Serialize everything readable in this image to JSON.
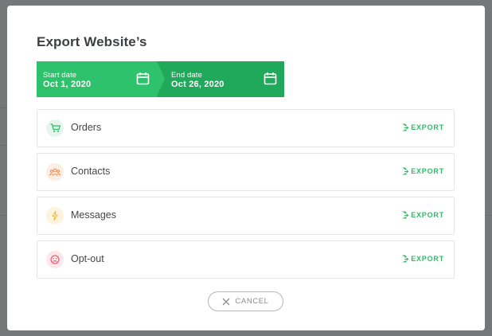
{
  "modal": {
    "title": "Export Website’s",
    "date_range": {
      "start_label": "Start date",
      "start_value": "Oct 1, 2020",
      "end_label": "End date",
      "end_value": "Oct 26, 2020"
    },
    "rows": [
      {
        "label": "Orders",
        "icon": "cart-icon",
        "action": "EXPORT",
        "icon_color": "#2dbb66",
        "icon_bg": "#e6f6ec"
      },
      {
        "label": "Contacts",
        "icon": "people-icon",
        "action": "EXPORT",
        "icon_color": "#f08a4b",
        "icon_bg": "#fdeee4"
      },
      {
        "label": "Messages",
        "icon": "bolt-icon",
        "action": "EXPORT",
        "icon_color": "#f5b82e",
        "icon_bg": "#fdf4de"
      },
      {
        "label": "Opt-out",
        "icon": "frown-icon",
        "action": "EXPORT",
        "icon_color": "#e5485f",
        "icon_bg": "#fde7ea"
      }
    ],
    "cancel_label": "CANCEL"
  },
  "colors": {
    "accent": "#2dc26b",
    "accent_dark": "#20a95a",
    "export_text": "#2dbb66"
  }
}
